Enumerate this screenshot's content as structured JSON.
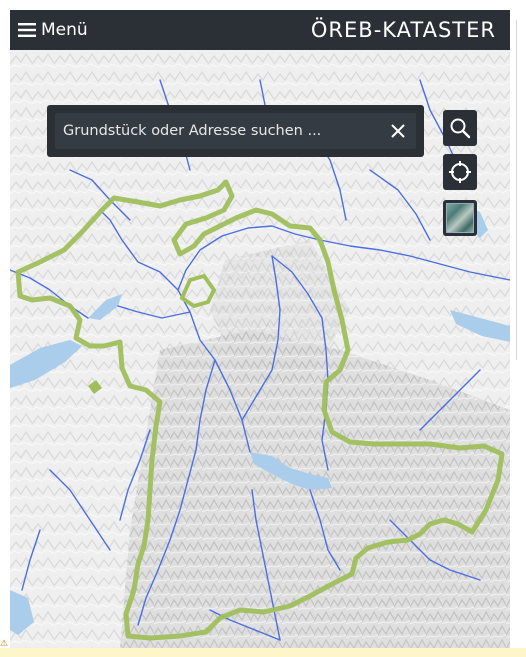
{
  "header": {
    "menu_label": "Menü",
    "title": "ÖREB-KATASTER",
    "menu_icon": "hamburger-icon"
  },
  "search": {
    "placeholder": "Grundstück oder Adresse suchen ...",
    "clear_icon": "close-icon"
  },
  "map_controls": {
    "search_icon": "magnifier-icon",
    "locate_icon": "crosshair-icon",
    "layer_icon": "basemap-thumbnail-icon"
  },
  "colors": {
    "header_bg": "#2b3036",
    "canton_border": "#9fbf5c",
    "rivers": "#4a6fe0",
    "lakes": "#a9cdea",
    "terrain": "#eeeeee"
  },
  "status": {
    "warning_icon": "warning-icon"
  }
}
